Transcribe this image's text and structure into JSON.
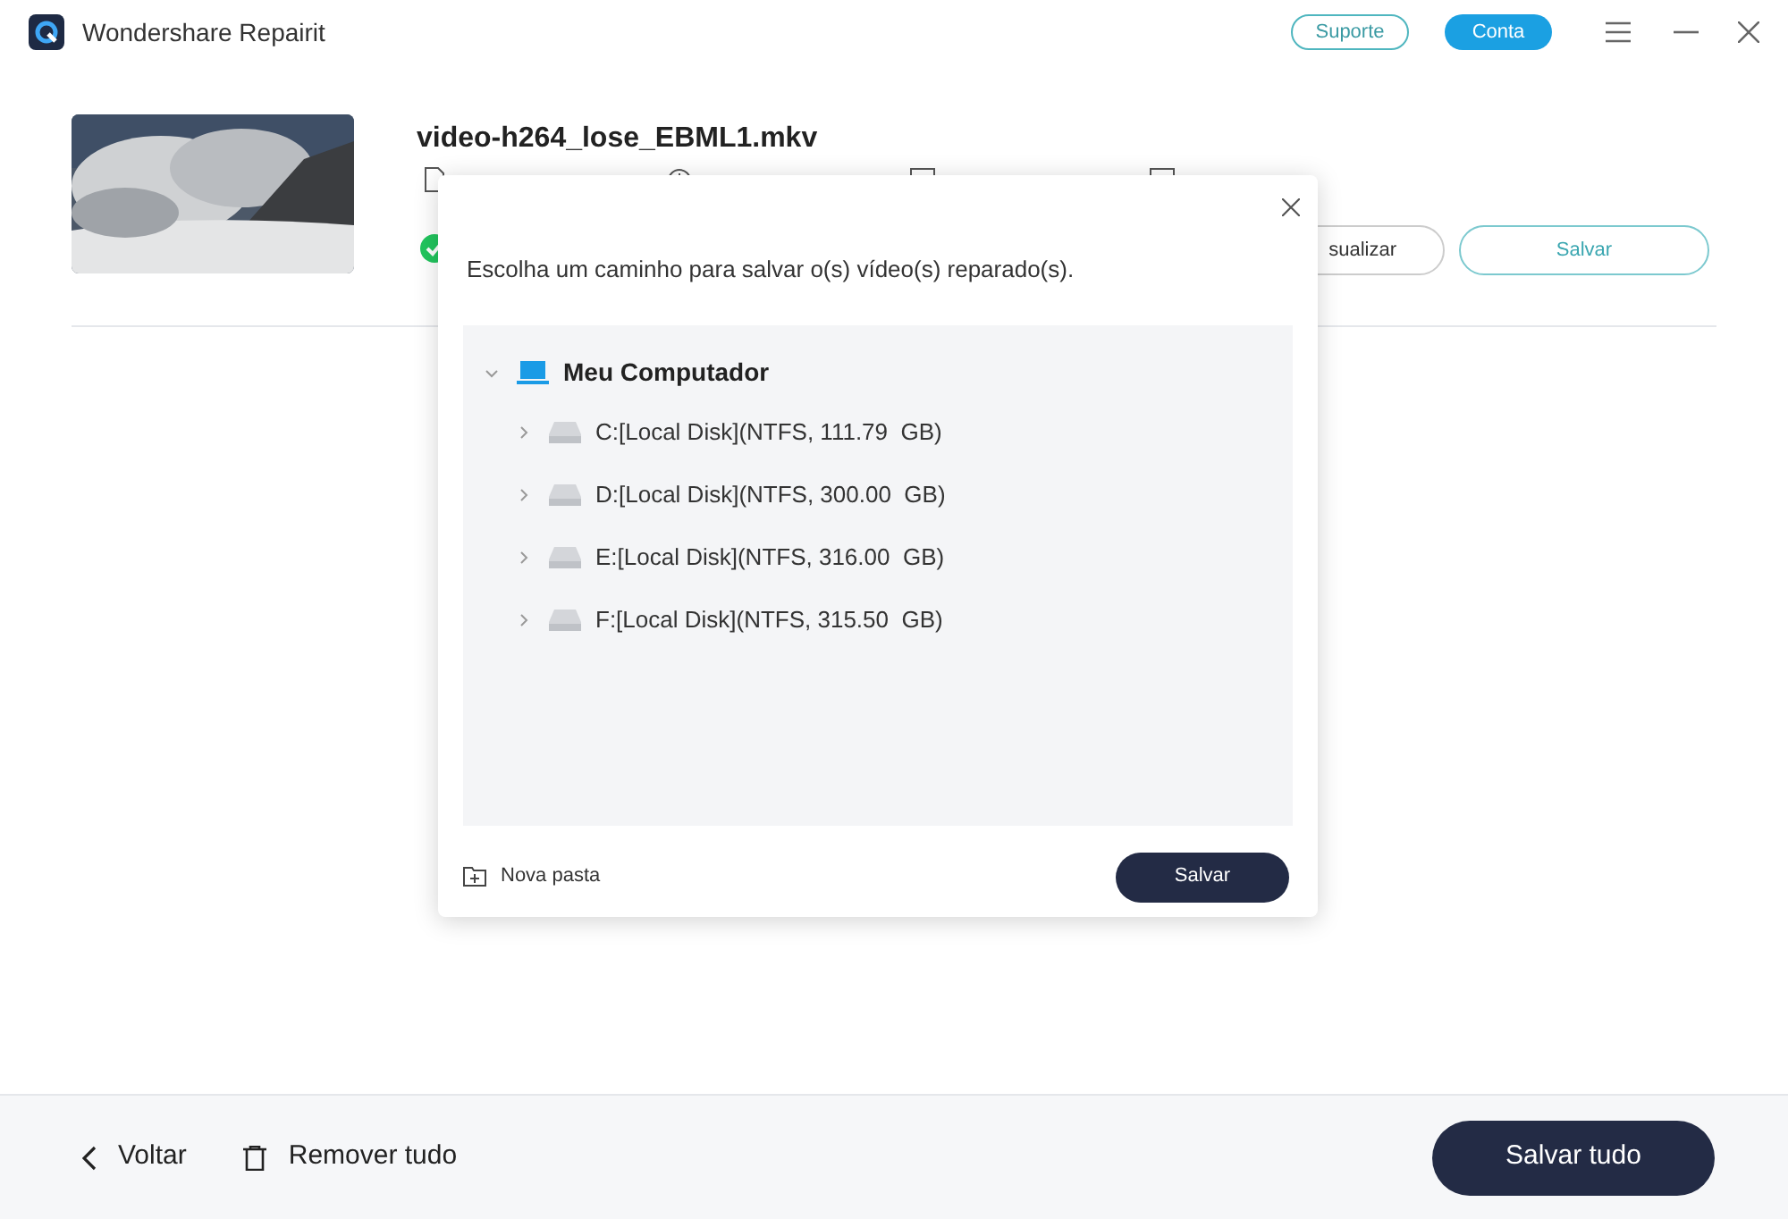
{
  "window": {
    "title": "Wondershare Repairit"
  },
  "header_buttons": [
    {
      "label": "Suporte",
      "kind": "outline"
    },
    {
      "label": "Conta",
      "kind": "filled"
    }
  ],
  "video": {
    "kind": "picture",
    "filename": "video-h264_lose_EBML1.mkv",
    "repaired": true,
    "preview_label": "sualizar",
    "save_label": "Salvar"
  },
  "dialog": {
    "message": "Escolha um caminho para salvar o(s) vídeo(s) reparado(s).",
    "tree": [
      {
        "label": "Meu Computador",
        "kind": "computer",
        "expanded": true,
        "children": [
          {
            "label": "C:[Local Disk](NTFS, 111.79  GB)",
            "kind": "disk",
            "expanded": false
          },
          {
            "label": "D:[Local Disk](NTFS, 300.00  GB)",
            "kind": "disk",
            "expanded": false
          },
          {
            "label": "E:[Local Disk](NTFS, 316.00  GB)",
            "kind": "disk",
            "expanded": false
          },
          {
            "label": "F:[Local Disk](NTFS, 315.50  GB)",
            "kind": "disk",
            "expanded": false
          }
        ]
      }
    ],
    "new_folder": "Nova pasta",
    "save": "Salvar"
  },
  "footer": {
    "back": "Voltar",
    "remove_all": "Remover tudo",
    "save_all": "Salvar tudo"
  }
}
